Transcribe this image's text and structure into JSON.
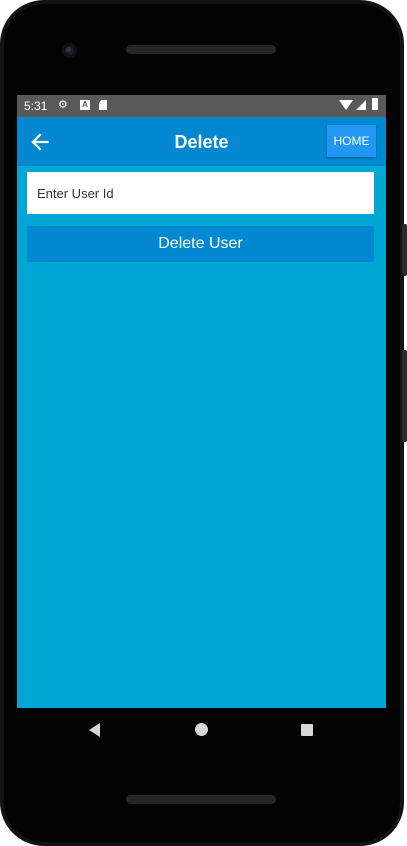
{
  "status_bar": {
    "time": "5:31",
    "icons": [
      "gear-icon",
      "a-notification-icon",
      "sd-card-icon",
      "wifi-icon",
      "signal-icon",
      "battery-icon"
    ]
  },
  "app_bar": {
    "title": "Delete",
    "back_icon": "arrow-left-icon",
    "home_label": "HOME"
  },
  "form": {
    "user_id_placeholder": "Enter User Id",
    "user_id_value": "",
    "delete_button_label": "Delete User"
  },
  "nav_bar": {
    "icons": [
      "back-triangle-icon",
      "home-circle-icon",
      "recents-square-icon"
    ]
  },
  "colors": {
    "screen_background": "#00a7d4",
    "app_bar": "#0288d1",
    "home_button": "#2196f3",
    "delete_button": "#0288d1",
    "status_bar": "#595959"
  }
}
